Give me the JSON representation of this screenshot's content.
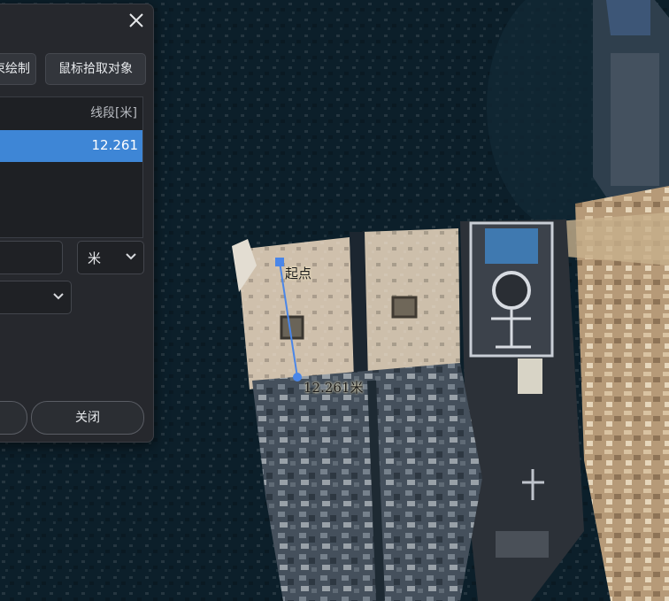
{
  "dialog": {
    "draw_button_label": "束绘制",
    "pick_button_label": "鼠标拾取对象",
    "table_header_segment": "线段[米]",
    "selected_row_value": "12.261",
    "unit_select_value": "米",
    "close_button_label": "关闭"
  },
  "map": {
    "start_label": "起点",
    "measure_label": "12.261米"
  },
  "colors": {
    "water": "#0c1f2a",
    "dialog_bg": "#26282d",
    "selection": "#3e86d6",
    "measure_line": "#4a86e8"
  }
}
